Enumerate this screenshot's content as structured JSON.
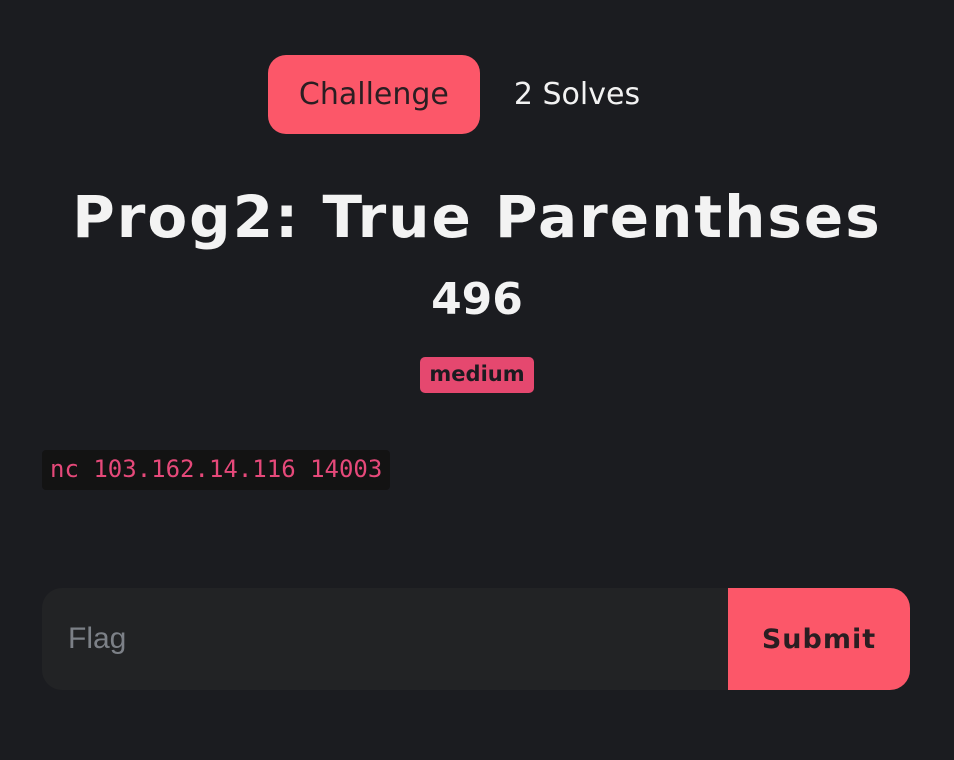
{
  "tabs": {
    "challenge_label": "Challenge",
    "solves_label": "2 Solves"
  },
  "challenge": {
    "name": "Prog2: True Parenthses",
    "points": "496",
    "tag": "medium",
    "description_code": "nc 103.162.14.116 14003"
  },
  "form": {
    "flag_placeholder": "Flag",
    "flag_value": "",
    "submit_label": "Submit"
  },
  "colors": {
    "background": "#1b1c20",
    "accent": "#fc5769",
    "tag": "#e5486f",
    "code_text": "#e6497a",
    "input_bg": "#222325"
  }
}
